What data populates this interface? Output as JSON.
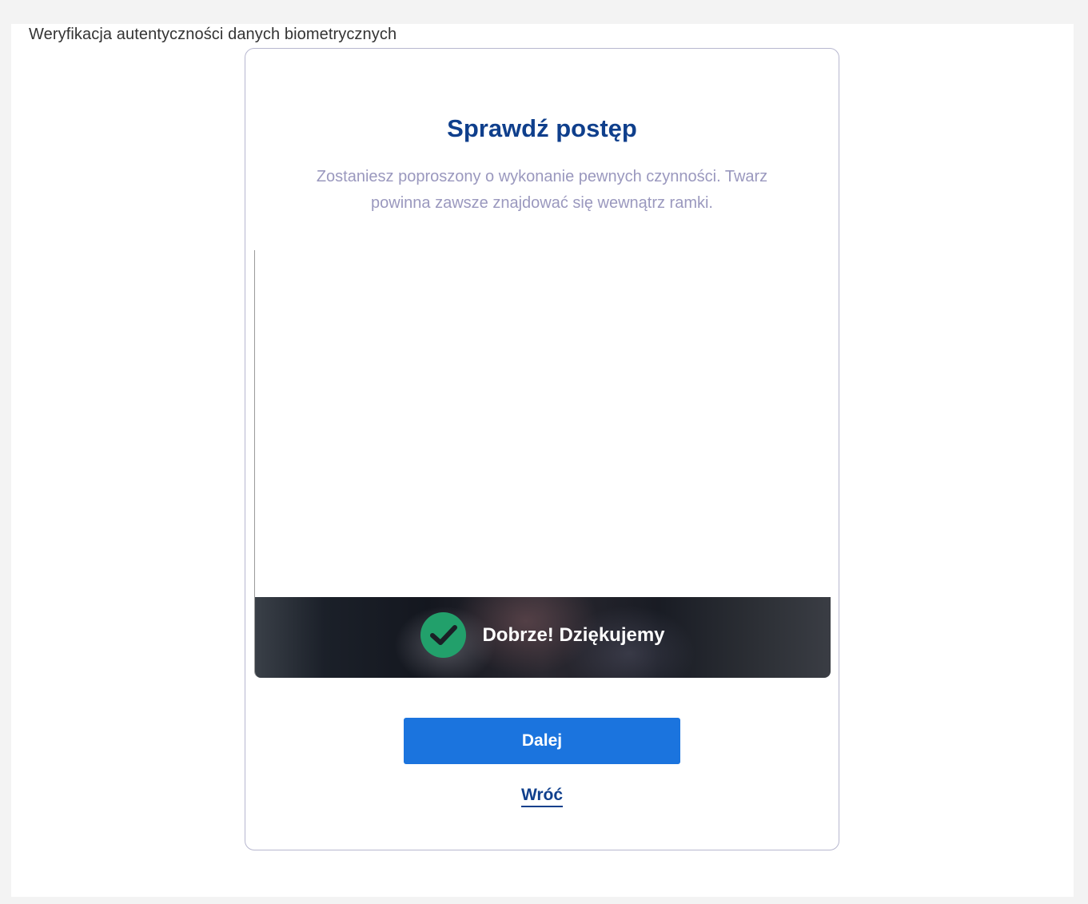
{
  "page": {
    "title": "Weryfikacja autentyczności danych biometrycznych"
  },
  "card": {
    "heading": "Sprawdź postęp",
    "description": "Zostaniesz poproszony o wykonanie pewnych czynności. Twarz powinna zawsze znajdować się wewnątrz ramki.",
    "feedback": {
      "icon": "check-circle-icon",
      "text": "Dobrze! Dziękujemy",
      "icon_color": "#22a06b"
    },
    "next_label": "Dalej",
    "back_label": "Wróć"
  },
  "colors": {
    "heading": "#0f3f8c",
    "description": "#9a98be",
    "primary_button": "#1b74de"
  }
}
